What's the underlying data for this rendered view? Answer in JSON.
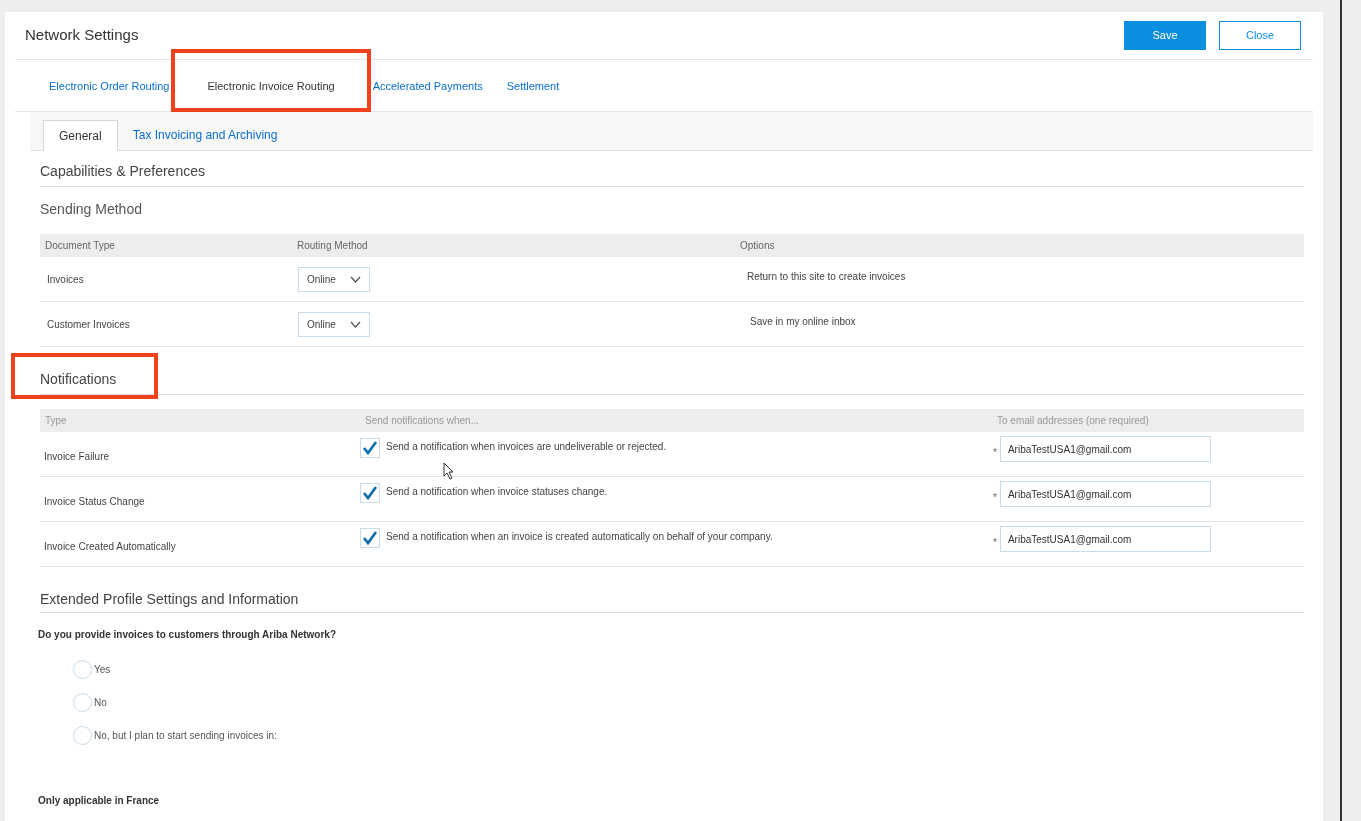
{
  "window": {
    "title": "Network Settings"
  },
  "buttons": [
    {
      "label": "Save",
      "kind": "primary"
    },
    {
      "label": "Close",
      "kind": "secondary"
    }
  ],
  "tabs": [
    {
      "label": "Electronic Order Routing",
      "selected": false,
      "highlighted": false
    },
    {
      "label": "Electronic Invoice Routing",
      "selected": true,
      "highlighted": true
    },
    {
      "label": "Accelerated Payments",
      "selected": false,
      "highlighted": false
    },
    {
      "label": "Settlement",
      "selected": false,
      "highlighted": false
    }
  ],
  "subtabs": [
    {
      "label": "General",
      "selected": true
    },
    {
      "label": "Tax Invoicing and Archiving",
      "selected": false
    }
  ],
  "capabilities_heading": "Capabilities & Preferences",
  "sending_method": {
    "heading": "Sending Method",
    "columns": [
      "Document Type",
      "Routing Method",
      "Options"
    ],
    "rows": [
      {
        "document_type": "Invoices",
        "routing_method": "Online",
        "option": "Return to this site to create invoices"
      },
      {
        "document_type": "Customer Invoices",
        "routing_method": "Online",
        "option": "Save in my online inbox"
      }
    ]
  },
  "notifications": {
    "heading": "Notifications",
    "highlighted": true,
    "columns": [
      "Type",
      "Send notifications when...",
      "To email addresses (one required)"
    ],
    "rows": [
      {
        "type": "Invoice Failure",
        "checked": true,
        "description": "Send a notification when invoices are undeliverable or rejected.",
        "required_mark": "*",
        "email": "AribaTestUSA1@gmail.com"
      },
      {
        "type": "Invoice Status Change",
        "checked": true,
        "description": "Send a notification when invoice statuses change.",
        "required_mark": "*",
        "email": "AribaTestUSA1@gmail.com"
      },
      {
        "type": "Invoice Created Automatically",
        "checked": true,
        "description": "Send a notification when an invoice is created automatically on behalf of your company.",
        "required_mark": "*",
        "email": "AribaTestUSA1@gmail.com"
      }
    ]
  },
  "extended_profile": {
    "heading": "Extended Profile Settings and Information",
    "question": "Do you provide invoices to customers through Ariba Network?",
    "options": [
      {
        "label": "Yes",
        "selected": false
      },
      {
        "label": "No",
        "selected": false
      },
      {
        "label": "No, but I plan to start sending invoices in:",
        "selected": false
      }
    ],
    "footnote": "Only applicable in France"
  }
}
